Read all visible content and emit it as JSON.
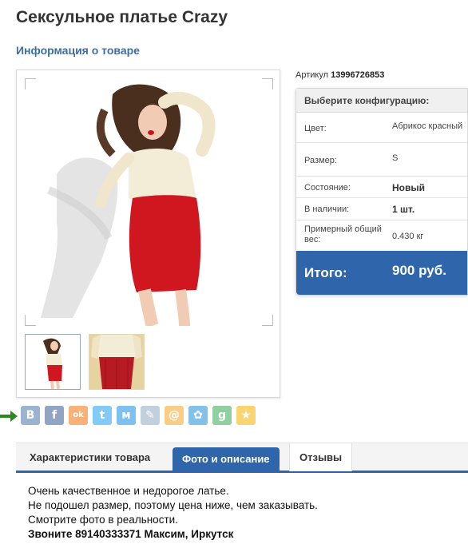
{
  "product": {
    "title": "Сексульное платье Crazy",
    "info_link": "Информация о товаре",
    "sku_label": "Артикул",
    "sku_value": "13996726853"
  },
  "config": {
    "header": "Выберите конфигурацию:",
    "color_label": "Цвет:",
    "color_value": "Абрикос красный",
    "size_label": "Размер:",
    "size_value": "S",
    "state_label": "Состояние:",
    "state_value": "Новый",
    "stock_label": "В наличии:",
    "stock_value": "1 шт.",
    "weight_label": "Примерный общий вес:",
    "weight_value": "0.430 кг",
    "total_label": "Итого:",
    "total_value": "900 руб."
  },
  "share": {
    "buttons": [
      {
        "name": "vkontakte-icon",
        "glyph": "В",
        "color": "#4a76a8"
      },
      {
        "name": "facebook-icon",
        "glyph": "f",
        "color": "#3b5998"
      },
      {
        "name": "odnoklassniki-icon",
        "glyph": "ok",
        "color": "#f2720c"
      },
      {
        "name": "twitter-icon",
        "glyph": "t",
        "color": "#1da1f2"
      },
      {
        "name": "moimir-icon",
        "glyph": "м",
        "color": "#168de2"
      },
      {
        "name": "livejournal-icon",
        "glyph": "✎",
        "color": "#8fa9c4"
      },
      {
        "name": "mailru-icon",
        "glyph": "@",
        "color": "#f5a623"
      },
      {
        "name": "settings-share-icon",
        "glyph": "✿",
        "color": "#1e90d8"
      },
      {
        "name": "googleplus-icon",
        "glyph": "g",
        "color": "#34a853"
      },
      {
        "name": "favorites-star-icon",
        "glyph": "★",
        "color": "#f4b400"
      }
    ]
  },
  "tabs": {
    "characteristics": "Характеристики товара",
    "photo_desc": "Фото и описание",
    "reviews": "Отзывы"
  },
  "description": {
    "line1": "Очень качественное и недорогое латье.",
    "line2": "Не подошел размер, поэтому цена ниже, чем заказывать.",
    "line3": "Смотрите фото в реальности.",
    "line4": "Звоните 89140333371 Максим, Иркутск"
  },
  "colors": {
    "accent": "#2f66ab",
    "link": "#3a6ea5",
    "dress_red": "#d0161e",
    "lace": "#f3ecd6",
    "arrow": "#2a8a1e"
  }
}
